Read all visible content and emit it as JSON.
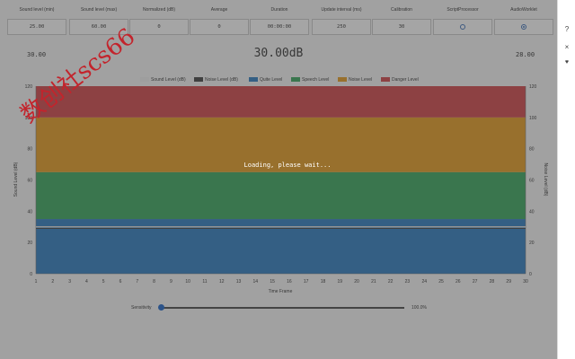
{
  "controls": {
    "sound_min": {
      "header": "Sound level (min)",
      "value": "25.00"
    },
    "sound_max": {
      "header": "Sound level (max)",
      "value": "60.00"
    },
    "normalized": {
      "header": "Normalized (dB)",
      "value": "0"
    },
    "average": {
      "header": "Average",
      "value": "0"
    },
    "duration": {
      "header": "Duration",
      "value": "00:00:00"
    },
    "update_interval": {
      "header": "Update interval (ms)",
      "value": "250"
    },
    "calibration": {
      "header": "Calibration",
      "value": "30"
    },
    "script_processor": {
      "header": "ScriptProcessor",
      "checked": false
    },
    "audio_worklet": {
      "header": "AudioWorklet",
      "checked": true
    }
  },
  "readout": {
    "min": "30.00",
    "current": "30.00dB",
    "max": "28.00"
  },
  "sidebar": {
    "close": "×",
    "help": "?",
    "heart": "♥"
  },
  "overlay": {
    "loading": "Loading, please wait...",
    "watermark": "数创社scs66"
  },
  "sensitivity": {
    "label": "Sensitivity",
    "value": "100.0%",
    "fraction": 1.0
  },
  "colors": {
    "quiet": "#2f7cc0",
    "speech": "#3aa65e",
    "noise": "#e39b22",
    "danger": "#d0454a",
    "noise_line": "#444444",
    "sound_line": "#dddddd"
  },
  "chart_data": {
    "type": "area",
    "legend": [
      {
        "name": "Sound Level (dB)",
        "color": "#eeeeee"
      },
      {
        "name": "Noise Level (dB)",
        "color": "#444444"
      },
      {
        "name": "Quite Level",
        "color": "#2f7cc0"
      },
      {
        "name": "Speech Level",
        "color": "#3aa65e"
      },
      {
        "name": "Noise Level",
        "color": "#e39b22"
      },
      {
        "name": "Danger Level",
        "color": "#d0454a"
      }
    ],
    "bands": [
      {
        "name": "Quite Level",
        "from": 0,
        "to": 35,
        "color": "#2f7cc0"
      },
      {
        "name": "Speech Level",
        "from": 35,
        "to": 65,
        "color": "#3aa65e"
      },
      {
        "name": "Noise Level",
        "from": 65,
        "to": 100,
        "color": "#e39b22"
      },
      {
        "name": "Danger Level",
        "from": 100,
        "to": 120,
        "color": "#d0454a"
      }
    ],
    "series": [
      {
        "name": "Sound Level (dB)",
        "values": [
          30,
          30,
          30,
          30,
          30,
          30,
          30,
          30,
          30,
          30,
          30,
          30,
          30,
          30,
          30,
          30,
          30,
          30,
          30,
          30,
          30,
          30,
          30,
          30,
          30,
          30,
          30,
          30,
          30,
          30
        ]
      },
      {
        "name": "Noise Level (dB)",
        "values": [
          29,
          29,
          29,
          29,
          29,
          29,
          29,
          29,
          29,
          29,
          29,
          29,
          29,
          29,
          29,
          29,
          29,
          29,
          29,
          29,
          29,
          29,
          29,
          29,
          29,
          29,
          29,
          29,
          29,
          29
        ]
      }
    ],
    "x": [
      1,
      2,
      3,
      4,
      5,
      6,
      7,
      8,
      9,
      10,
      11,
      12,
      13,
      14,
      15,
      16,
      17,
      18,
      19,
      20,
      21,
      22,
      23,
      24,
      25,
      26,
      27,
      28,
      29,
      30
    ],
    "xlabel": "Time Frame",
    "ylabel": "Sound Level (dB)",
    "y2label": "Noise Level (dB)",
    "ylim": [
      0,
      120
    ],
    "yticks": [
      0,
      20,
      40,
      60,
      80,
      100,
      120
    ],
    "legend_position": "top"
  }
}
